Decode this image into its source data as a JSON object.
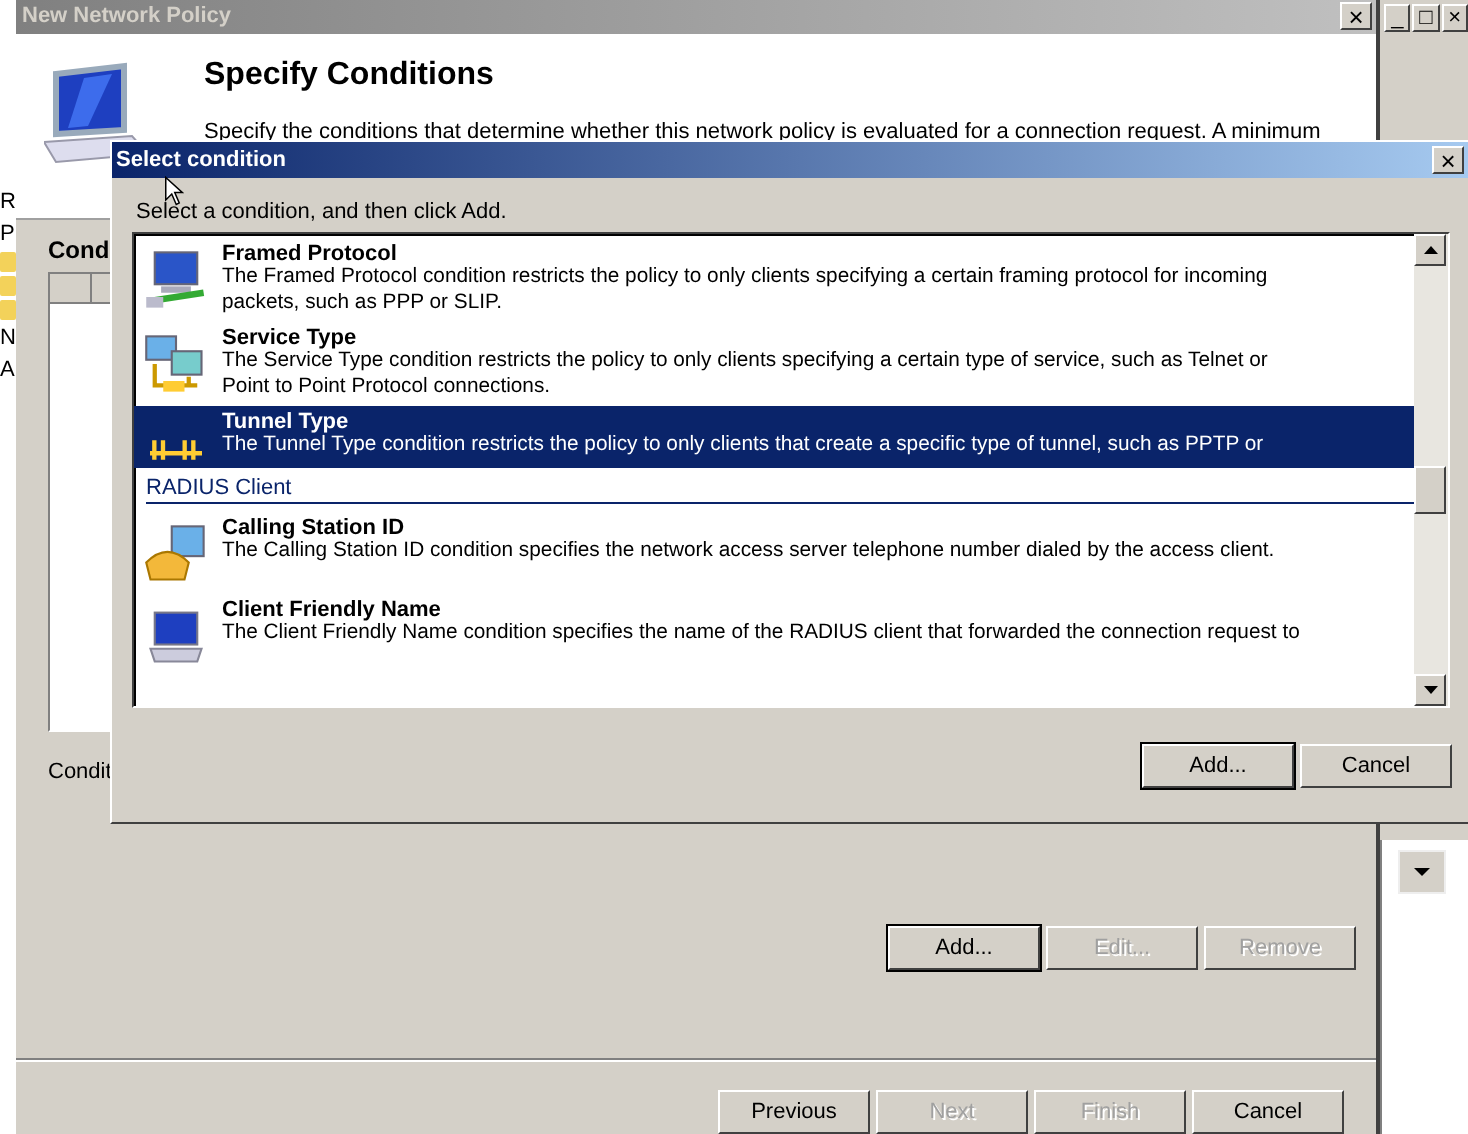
{
  "background_app": {
    "tree_items": [
      {
        "label": "R",
        "kind": "text"
      },
      {
        "label": "P",
        "kind": "text"
      },
      {
        "kind": "folder"
      },
      {
        "kind": "folder"
      },
      {
        "kind": "folder"
      },
      {
        "label": "N",
        "kind": "text"
      },
      {
        "label": "A",
        "kind": "text"
      }
    ],
    "title_buttons": [
      "_",
      "□",
      "×"
    ]
  },
  "wizard": {
    "window": {
      "title": "New Network Policy",
      "close": "×"
    },
    "heading": "Specify Conditions",
    "description": "Specify the conditions that determine whether this network policy is evaluated for a connection request. A minimum",
    "conditions_label": "Cond",
    "condition_caption": "Condit",
    "condition_buttons": [
      {
        "label": "Add...",
        "disabled": false
      },
      {
        "label": "Edit...",
        "disabled": true
      },
      {
        "label": "Remove",
        "disabled": true
      }
    ],
    "nav_buttons": [
      {
        "label": "Previous",
        "disabled": false
      },
      {
        "label": "Next",
        "disabled": true
      },
      {
        "label": "Finish",
        "disabled": true
      },
      {
        "label": "Cancel",
        "disabled": false
      }
    ]
  },
  "dialog": {
    "window": {
      "title": "Select condition",
      "close": "×"
    },
    "instruction": "Select a condition, and then click Add.",
    "items": [
      {
        "kind": "condition",
        "name": "Framed Protocol",
        "description": [
          "The Framed Protocol condition restricts the policy to only clients specifying a certain framing protocol for incoming",
          "packets, such as PPP or SLIP."
        ],
        "selected": false
      },
      {
        "kind": "condition",
        "name": "Service Type",
        "description": [
          "The Service Type condition restricts the policy to only clients specifying a certain type of service, such as Telnet or",
          "Point to Point Protocol connections."
        ],
        "selected": false
      },
      {
        "kind": "condition",
        "name": "Tunnel Type",
        "description": [
          "The Tunnel Type condition restricts the policy to only clients that create a specific type of tunnel, such as PPTP or"
        ],
        "selected": true
      },
      {
        "kind": "group",
        "name": "RADIUS Client"
      },
      {
        "kind": "condition",
        "name": "Calling Station ID",
        "description": [
          "The Calling Station ID condition specifies the network access server telephone number dialed by the access client."
        ],
        "selected": false
      },
      {
        "kind": "condition",
        "name": "Client Friendly Name",
        "description": [
          "The Client Friendly Name condition specifies the name of the RADIUS client that forwarded the connection request to"
        ],
        "selected": false
      }
    ],
    "buttons": [
      {
        "label": "Add...",
        "default": true
      },
      {
        "label": "Cancel",
        "default": false
      }
    ]
  }
}
